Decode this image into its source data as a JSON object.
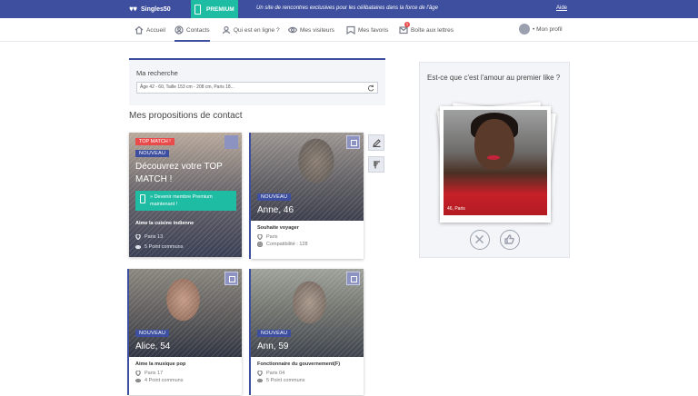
{
  "topbar": {
    "logo": "Singles50",
    "premium_label": "PREMIUM",
    "tagline": "Un site de rencontres exclusives pour les célibataires dans la force de l'âge",
    "help": "Aide"
  },
  "nav": {
    "items": [
      {
        "label": "Accueil",
        "icon": "home-icon"
      },
      {
        "label": "Contacts",
        "icon": "contacts-icon"
      },
      {
        "label": "Qui est en ligne ?",
        "icon": "online-icon"
      },
      {
        "label": "Mes visiteurs",
        "icon": "visitors-icon"
      },
      {
        "label": "Mes favoris",
        "icon": "favorites-icon"
      },
      {
        "label": "Boîte aux lettres",
        "icon": "mailbox-icon"
      }
    ],
    "mailbox_badge": "1",
    "profile_label": "• Mon profil"
  },
  "search": {
    "label": "Ma recherche",
    "value": "Âge 42 - 60, Taille 153 cm - 208 cm, Paris 18..."
  },
  "section_title": "Mes propositions de contact",
  "top_match": {
    "badge": "TOP MATCH !",
    "new": "NOUVEAU",
    "title": "Découvrez votre TOP MATCH !",
    "cta": "» Devenir membre Premium maintenant !",
    "interest": "Aime la cuisine indienne",
    "location": "Paris 13",
    "common": "5 Point communs"
  },
  "cards": [
    {
      "new": "NOUVEAU",
      "name": "Anne, 46",
      "tagline": "Souhaite voyager",
      "location": "Paris",
      "common": "Compatibilité : 128"
    },
    {
      "new": "NOUVEAU",
      "name": "Alice, 54",
      "tagline": "Aime la musique pop",
      "location": "Paris 17",
      "common": "4 Point communs"
    },
    {
      "new": "NOUVEAU",
      "name": "Ann, 59",
      "tagline": "Fonctionnaire du gouvernement(F)",
      "location": "Paris 04",
      "common": "5 Point communs"
    }
  ],
  "like_panel": {
    "question": "Est-ce que c'est l'amour au premier like ?",
    "caption": "46, Paris"
  },
  "colors": {
    "primary": "#3d4f9e",
    "accent": "#1fbca4",
    "top_match": "#e94a4a"
  }
}
